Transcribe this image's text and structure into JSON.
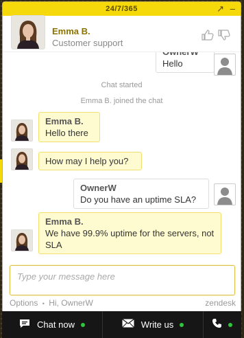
{
  "topbar": {
    "title": "24/7/365",
    "popout_icon": "arrow-out-icon",
    "minimize_icon": "minimize-icon"
  },
  "agent": {
    "name": "Emma B.",
    "role": "Customer support"
  },
  "rating": {
    "up_icon": "thumbs-up-icon",
    "down_icon": "thumbs-down-icon"
  },
  "log": {
    "top_user": {
      "name": "OwnerW",
      "text": "Hello"
    },
    "system": [
      "Chat started",
      "Emma B. joined the chat"
    ],
    "messages": [
      {
        "who": "agent",
        "name": "Emma B.",
        "text": "Hello there"
      },
      {
        "who": "agent",
        "name": "",
        "text": "How may I help you?"
      },
      {
        "who": "user",
        "name": "OwnerW",
        "text": "Do you have an uptime SLA?"
      },
      {
        "who": "agent",
        "name": "Emma B.",
        "text": "We have 99.9% uptime for the servers, not SLA"
      }
    ]
  },
  "composer": {
    "placeholder": "Type your message here"
  },
  "footer": {
    "options": "Options",
    "separator": "•",
    "greeting": "Hi, OwnerW",
    "brand": "zendesk"
  },
  "bottombar": [
    {
      "label": "Chat now",
      "icon": "chat-icon",
      "status": "online"
    },
    {
      "label": "Write us",
      "icon": "envelope-icon",
      "status": "online"
    },
    {
      "label": "",
      "icon": "phone-icon",
      "status": "online"
    }
  ],
  "colors": {
    "accent": "#f5d90a",
    "agent_bubble": "#fffbd0",
    "online": "#2ec73a",
    "bar": "#161616"
  }
}
